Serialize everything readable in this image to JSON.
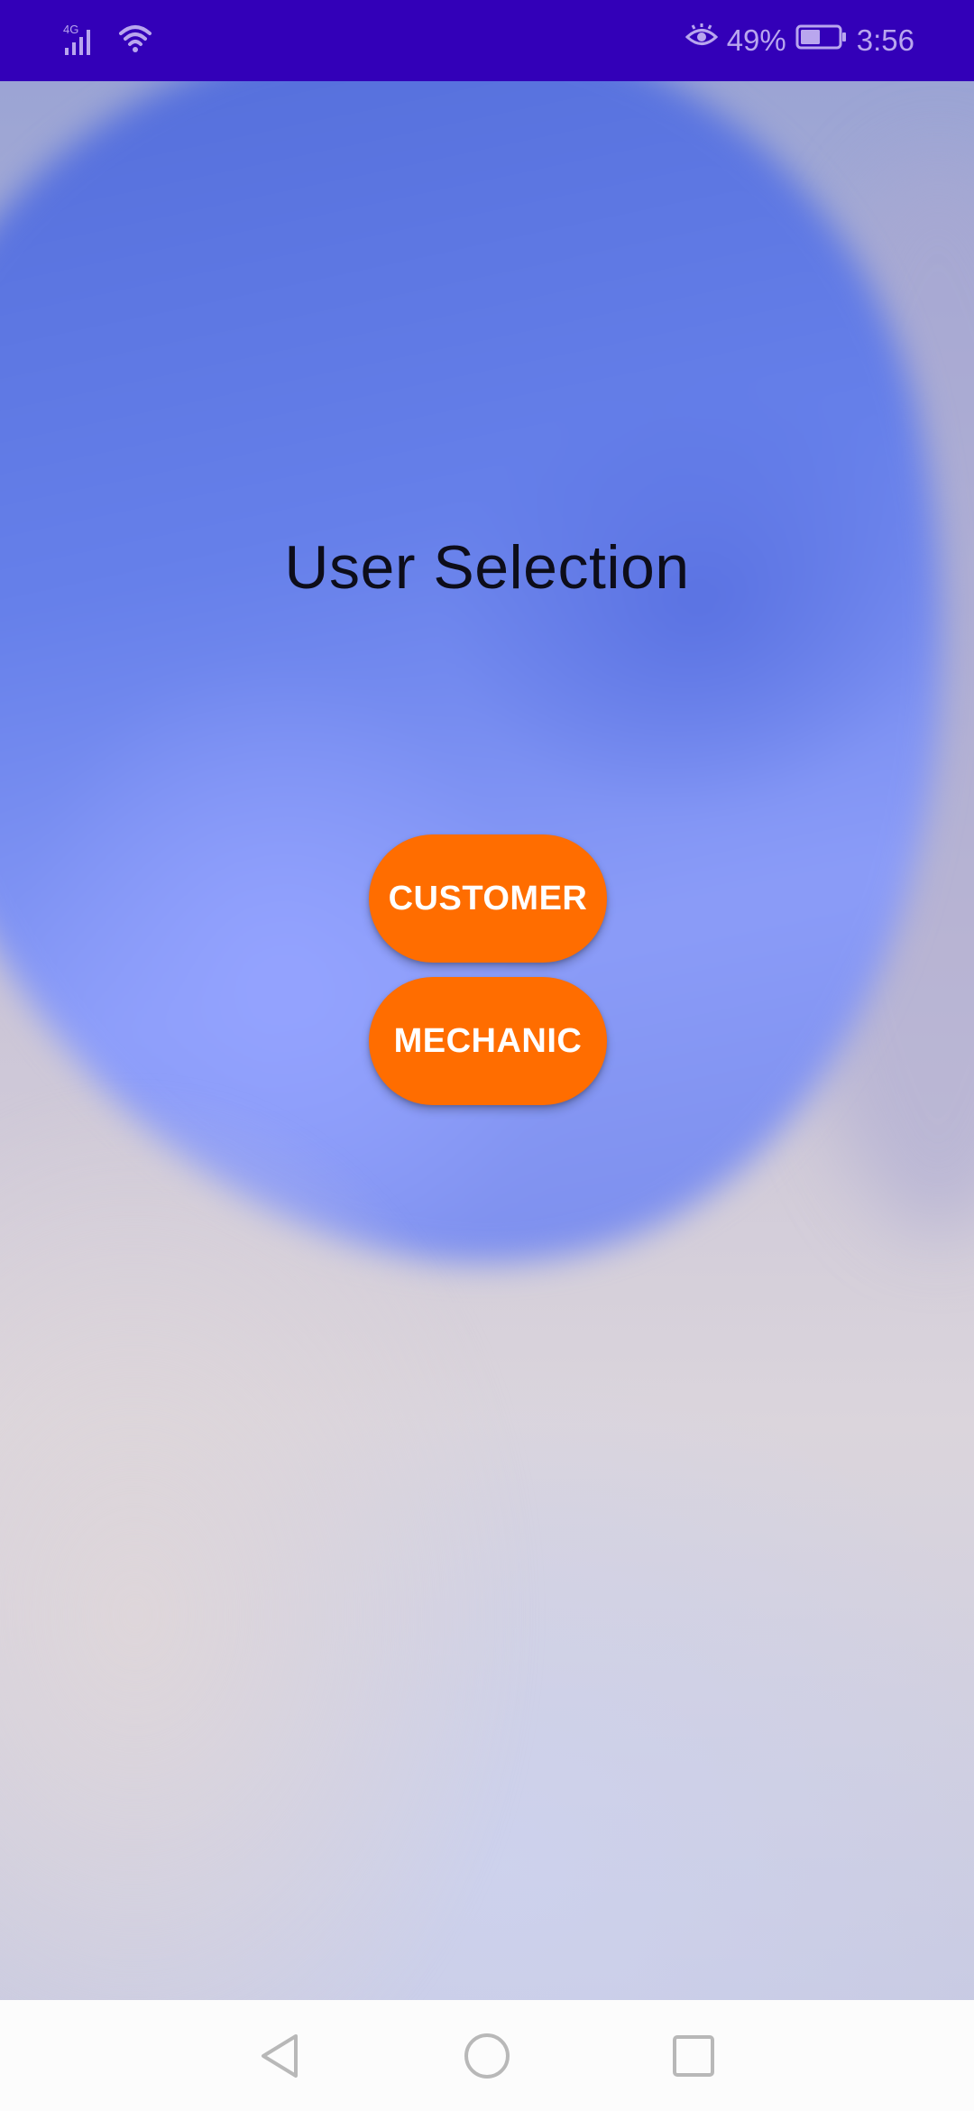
{
  "status_bar": {
    "network": "4G",
    "battery_percent": "49%",
    "time": "3:56",
    "background_color": "#3300b8",
    "icons": [
      "signal-icon",
      "wifi-icon",
      "eye-comfort-icon",
      "battery-icon"
    ]
  },
  "main": {
    "title": "User Selection",
    "buttons": {
      "customer_label": "CUSTOMER",
      "mechanic_label": "MECHANIC"
    },
    "accent_color": "#ff6d00"
  },
  "nav_bar": {
    "icons": [
      "back-icon",
      "home-icon",
      "recent-apps-icon"
    ]
  }
}
